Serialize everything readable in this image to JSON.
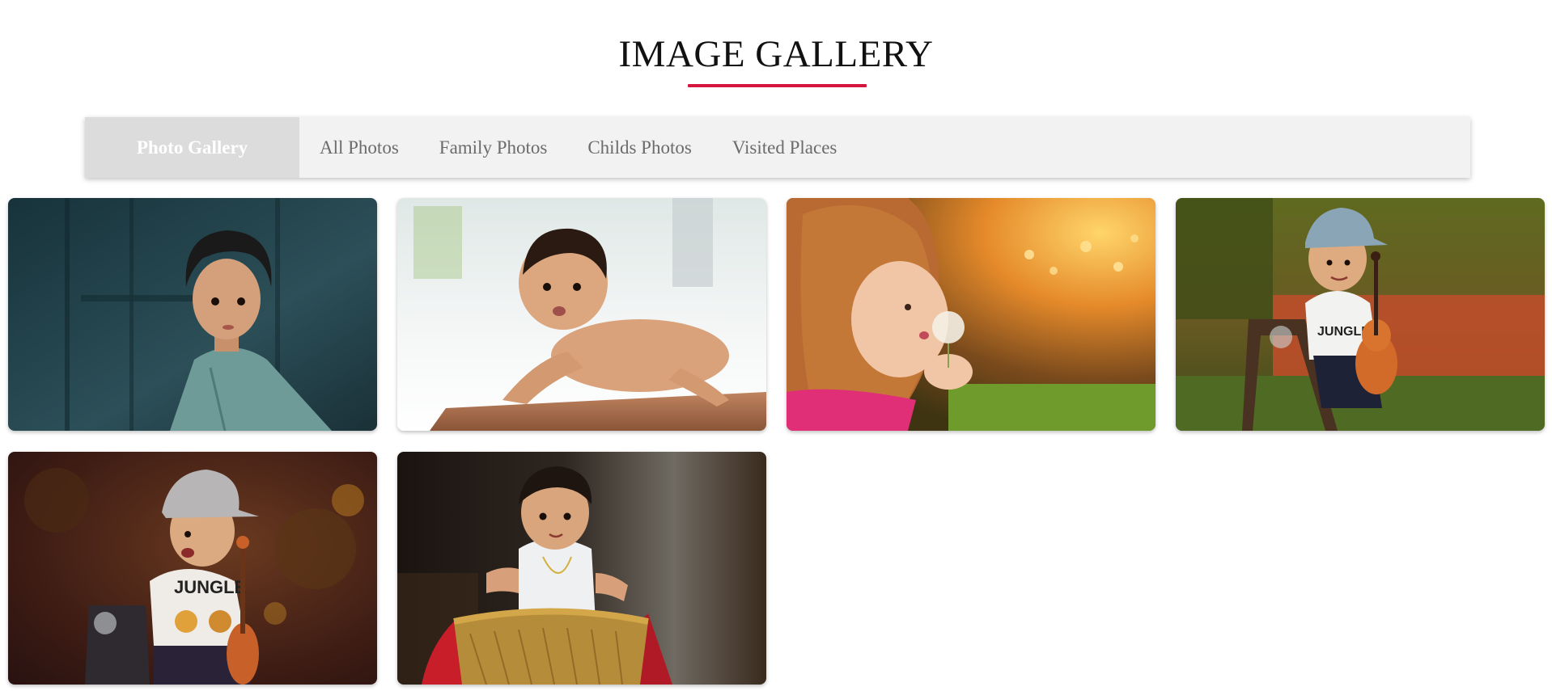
{
  "header": {
    "title": "IMAGE GALLERY",
    "underline_color": "#d6163f"
  },
  "navbar": {
    "brand": "Photo Gallery",
    "links": [
      "All Photos",
      "Family Photos",
      "Childs Photos",
      "Visited Places"
    ]
  },
  "gallery": {
    "photos": [
      {
        "subject": "curly-haired toddler in green shirt",
        "tones": [
          "#1f3a42",
          "#2f5560"
        ]
      },
      {
        "subject": "crawling baby on wooden floor",
        "tones": [
          "#e8eef0",
          "#b97a5a"
        ]
      },
      {
        "subject": "girl blowing dandelion",
        "tones": [
          "#f0a030",
          "#5d8a2a"
        ]
      },
      {
        "subject": "toddler with violin on chair",
        "tones": [
          "#4f5a1e",
          "#c0512c"
        ]
      },
      {
        "subject": "toddler in cap with violin",
        "tones": [
          "#4a1f18",
          "#7a3a22"
        ]
      },
      {
        "subject": "baby sitting in wicker basket",
        "tones": [
          "#2a2420",
          "#7a6a5a"
        ]
      }
    ]
  }
}
